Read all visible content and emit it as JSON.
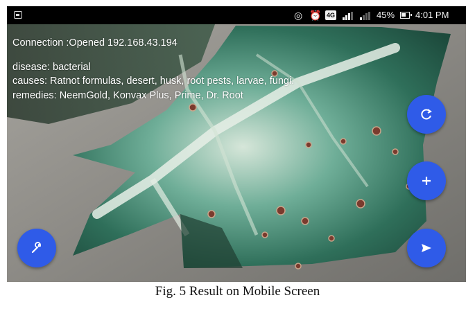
{
  "status_bar": {
    "battery_percent": "45%",
    "time": "4:01 PM",
    "network": "4G",
    "icons": [
      "app-notification-icon",
      "hotspot-icon",
      "alarm-icon",
      "4g-icon",
      "signal-icon",
      "signal-icon",
      "battery-icon"
    ]
  },
  "result": {
    "connection": "Connection :Opened 192.168.43.194",
    "disease": "disease: bacterial",
    "causes": "causes: Ratnot formulas, desert, husk, root pests, larvae, fungi.",
    "remedies": "remedies: NeemGold, Konvax Plus, Prime, Dr. Root"
  },
  "buttons": {
    "refresh_icon": "refresh-icon",
    "add_icon": "plus-icon",
    "send_icon": "send-icon",
    "settings_icon": "wrench-icon"
  },
  "colors": {
    "fab": "#2f5be8",
    "status_bar": "#000000",
    "overlay_text": "#ffffff"
  },
  "caption": "Fig. 5 Result on Mobile Screen"
}
